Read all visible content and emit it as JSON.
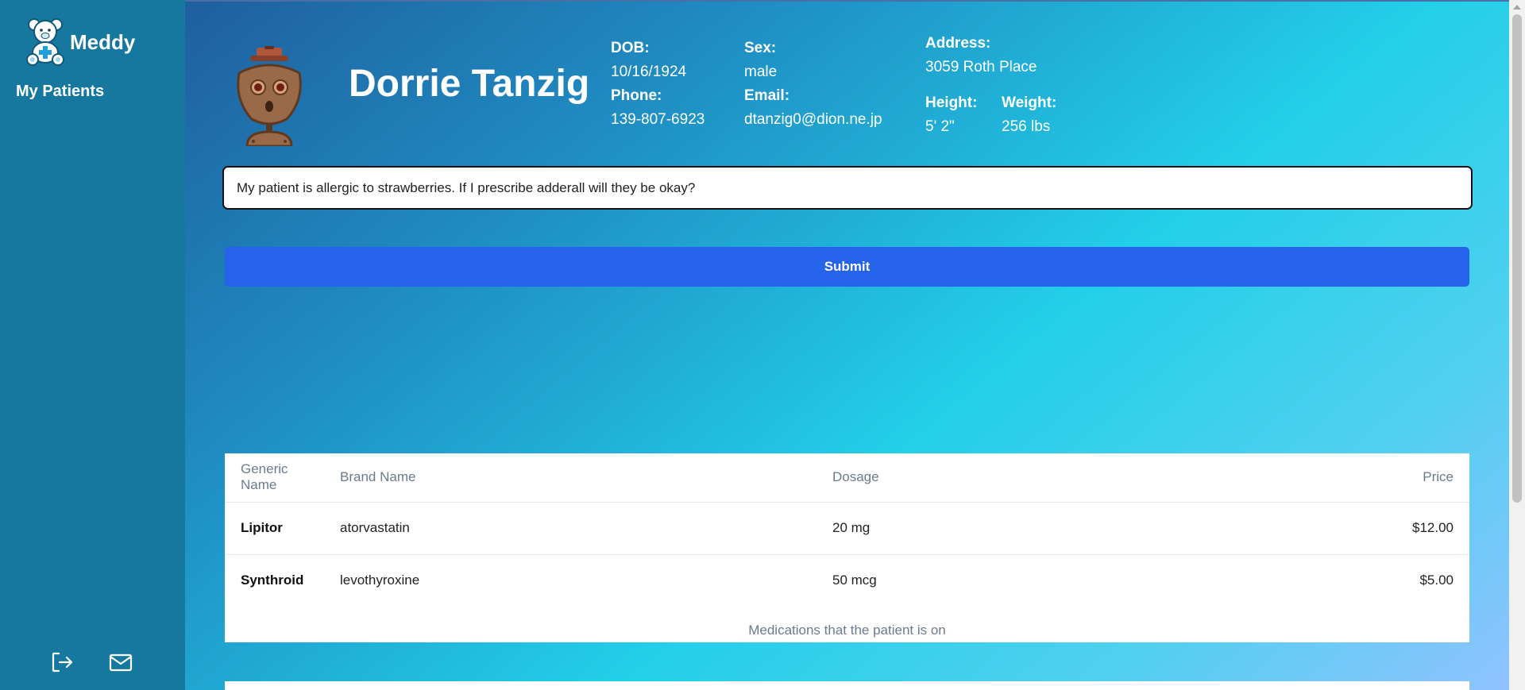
{
  "sidebar": {
    "brand_name": "Meddy",
    "nav_patients": "My Patients",
    "icons": [
      "logout-icon",
      "mail-icon"
    ]
  },
  "patient": {
    "name": "Dorrie Tanzig",
    "dob_label": "DOB:",
    "dob": "10/16/1924",
    "phone_label": "Phone:",
    "phone": "139-807-6923",
    "sex_label": "Sex:",
    "sex": "male",
    "email_label": "Email:",
    "email": "dtanzig0@dion.ne.jp",
    "address_label": "Address:",
    "address": "3059 Roth Place",
    "height_label": "Height:",
    "height": "5' 2\"",
    "weight_label": "Weight:",
    "weight": "256 lbs"
  },
  "query": {
    "value": "My patient is allergic to strawberries. If I prescribe adderall will they be okay?"
  },
  "submit_label": "Submit",
  "medications": {
    "headers": [
      "Generic Name",
      "Brand Name",
      "Dosage",
      "Price"
    ],
    "rows": [
      [
        "Lipitor",
        "atorvastatin",
        "20 mg",
        "$12.00"
      ],
      [
        "Synthroid",
        "levothyroxine",
        "50 mcg",
        "$5.00"
      ]
    ],
    "caption": "Medications that the patient is on"
  },
  "colors": {
    "sidebar_bg": "#17789f",
    "submit_bg": "#2563eb"
  }
}
